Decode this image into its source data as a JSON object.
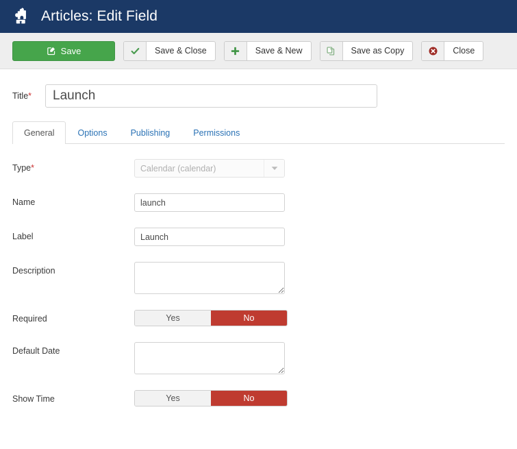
{
  "header": {
    "title": "Articles: Edit Field",
    "icon": "puzzle-piece-icon",
    "bg_color": "#1b3966"
  },
  "toolbar": {
    "buttons": [
      {
        "label": "Save",
        "icon": "pencil-square-icon",
        "style": "primary",
        "color": "#46a54b"
      },
      {
        "label": "Save & Close",
        "icon": "check-icon",
        "style": "split",
        "icon_color": "#4a9b4f"
      },
      {
        "label": "Save & New",
        "icon": "plus-icon",
        "style": "split",
        "icon_color": "#3f9444"
      },
      {
        "label": "Save as Copy",
        "icon": "copy-icon",
        "style": "split",
        "icon_color": "#7fae7f"
      },
      {
        "label": "Close",
        "icon": "circle-x-icon",
        "style": "split",
        "icon_color": "#9e2b25"
      }
    ]
  },
  "title_field": {
    "label": "Title",
    "required_marker": "*",
    "value": "Launch",
    "placeholder": ""
  },
  "tabs": [
    {
      "label": "General",
      "active": true
    },
    {
      "label": "Options",
      "active": false
    },
    {
      "label": "Publishing",
      "active": false
    },
    {
      "label": "Permissions",
      "active": false
    }
  ],
  "form": {
    "type": {
      "label": "Type",
      "required_marker": "*",
      "value": "Calendar (calendar)",
      "disabled": true,
      "arrow_icon": "chevron-down-icon"
    },
    "name": {
      "label": "Name",
      "value": "launch",
      "placeholder": ""
    },
    "field_label": {
      "label": "Label",
      "value": "Launch",
      "placeholder": ""
    },
    "description": {
      "label": "Description",
      "value": "",
      "placeholder": ""
    },
    "required": {
      "label": "Required",
      "yes_label": "Yes",
      "no_label": "No",
      "selected": "No",
      "active_color": "#bf3b30"
    },
    "default_date": {
      "label": "Default Date",
      "value": "",
      "placeholder": ""
    },
    "show_time": {
      "label": "Show Time",
      "yes_label": "Yes",
      "no_label": "No",
      "selected": "No",
      "active_color": "#bf3b30"
    }
  }
}
